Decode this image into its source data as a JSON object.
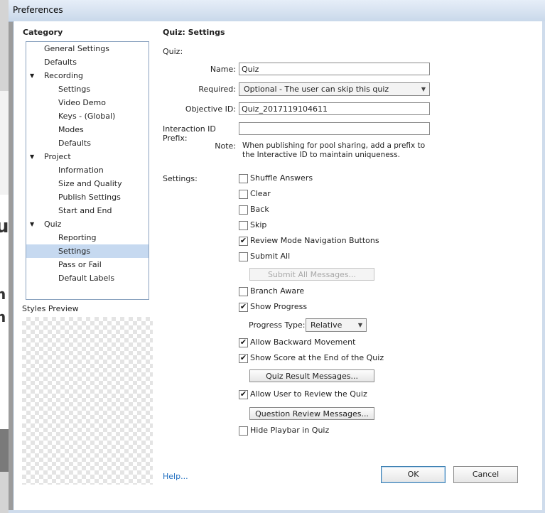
{
  "window": {
    "title": "Preferences"
  },
  "background": {
    "letters": [
      "u",
      "n",
      "n"
    ]
  },
  "category": {
    "heading": "Category",
    "items": [
      {
        "label": "General Settings",
        "level": 1,
        "expander": false,
        "selected": false
      },
      {
        "label": "Defaults",
        "level": 1,
        "expander": false,
        "selected": false
      },
      {
        "label": "Recording",
        "level": 1,
        "expander": true,
        "selected": false
      },
      {
        "label": "Settings",
        "level": 2,
        "expander": false,
        "selected": false
      },
      {
        "label": "Video Demo",
        "level": 2,
        "expander": false,
        "selected": false
      },
      {
        "label": "Keys - (Global)",
        "level": 2,
        "expander": false,
        "selected": false
      },
      {
        "label": "Modes",
        "level": 2,
        "expander": false,
        "selected": false
      },
      {
        "label": "Defaults",
        "level": 2,
        "expander": false,
        "selected": false
      },
      {
        "label": "Project",
        "level": 1,
        "expander": true,
        "selected": false
      },
      {
        "label": "Information",
        "level": 2,
        "expander": false,
        "selected": false
      },
      {
        "label": "Size and Quality",
        "level": 2,
        "expander": false,
        "selected": false
      },
      {
        "label": "Publish Settings",
        "level": 2,
        "expander": false,
        "selected": false
      },
      {
        "label": "Start and End",
        "level": 2,
        "expander": false,
        "selected": false
      },
      {
        "label": "Quiz",
        "level": 1,
        "expander": true,
        "selected": false
      },
      {
        "label": "Reporting",
        "level": 2,
        "expander": false,
        "selected": false
      },
      {
        "label": "Settings",
        "level": 2,
        "expander": false,
        "selected": true
      },
      {
        "label": "Pass or Fail",
        "level": 2,
        "expander": false,
        "selected": false
      },
      {
        "label": "Default Labels",
        "level": 2,
        "expander": false,
        "selected": false
      }
    ],
    "expander_glyph": "▼",
    "styles_preview_label": "Styles Preview",
    "help_link": "Help..."
  },
  "panel": {
    "title": "Quiz: Settings",
    "quiz_label": "Quiz:",
    "name": {
      "label": "Name:",
      "value": "Quiz"
    },
    "required": {
      "label": "Required:",
      "value": "Optional - The user can skip this quiz"
    },
    "objective_id": {
      "label": "Objective ID:",
      "value": "Quiz_2017119104611"
    },
    "interaction_prefix": {
      "label": "Interaction ID Prefix:",
      "value": ""
    },
    "note": {
      "label": "Note:",
      "text": "When publishing for pool sharing, add a prefix to the Interactive ID to maintain uniqueness."
    },
    "settings_label": "Settings:",
    "options": {
      "shuffle_answers": {
        "label": "Shuffle Answers",
        "checked": false
      },
      "clear": {
        "label": "Clear",
        "checked": false
      },
      "back": {
        "label": "Back",
        "checked": false
      },
      "skip": {
        "label": "Skip",
        "checked": false
      },
      "review_mode_nav": {
        "label": "Review Mode Navigation Buttons",
        "checked": true
      },
      "submit_all": {
        "label": "Submit All",
        "checked": false
      },
      "branch_aware": {
        "label": "Branch Aware",
        "checked": false
      },
      "show_progress": {
        "label": "Show Progress",
        "checked": true
      },
      "allow_backward": {
        "label": "Allow Backward Movement",
        "checked": true
      },
      "show_score": {
        "label": "Show Score at the End of the Quiz",
        "checked": true
      },
      "allow_review": {
        "label": "Allow User to Review the Quiz",
        "checked": true
      },
      "hide_playbar": {
        "label": "Hide Playbar in Quiz",
        "checked": false
      }
    },
    "progress_type": {
      "label": "Progress Type:",
      "value": "Relative"
    },
    "buttons": {
      "submit_all_messages": "Submit All Messages...",
      "quiz_result_messages": "Quiz Result Messages...",
      "question_review_messages": "Question Review Messages..."
    },
    "check_glyph": "✔",
    "caret_glyph": "▼"
  },
  "footer": {
    "ok": "OK",
    "cancel": "Cancel"
  }
}
